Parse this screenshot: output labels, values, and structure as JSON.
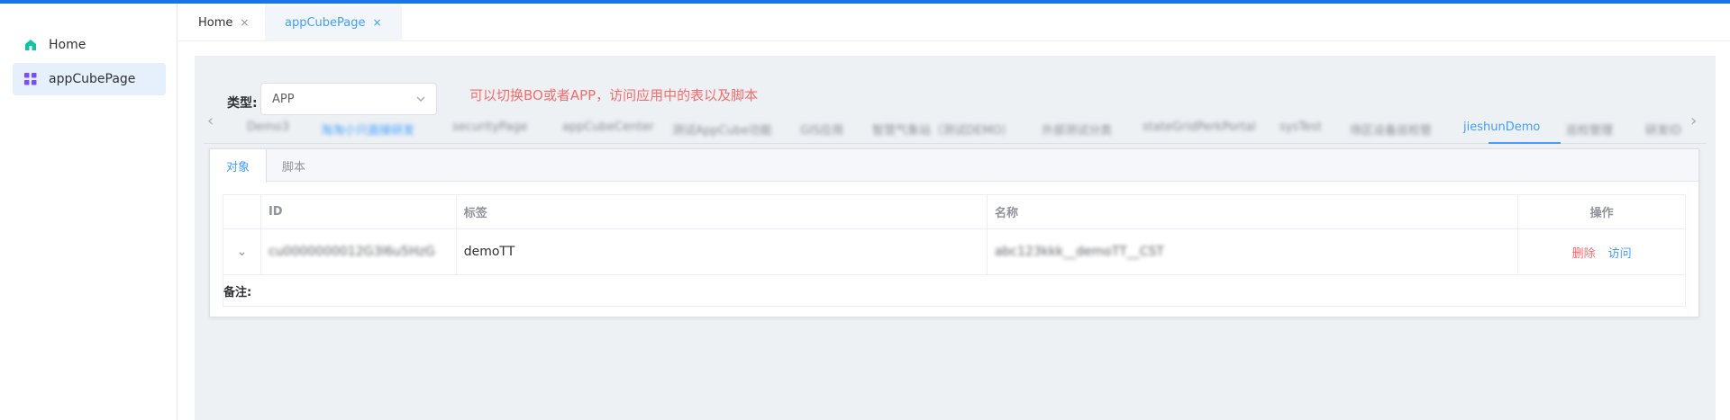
{
  "sidebar": {
    "items": [
      {
        "label": "Home",
        "icon": "home-icon",
        "active": false
      },
      {
        "label": "appCubePage",
        "icon": "grid-icon",
        "active": true
      }
    ]
  },
  "header": {
    "tabs": [
      {
        "label": "Home",
        "close": "×",
        "active": false
      },
      {
        "label": "appCubePage",
        "close": "×",
        "active": true
      }
    ]
  },
  "filter": {
    "type_label": "类型:",
    "type_value": "APP",
    "hint": "可以切换BO或者APP，访问应用中的表以及脚本"
  },
  "app_tabs": {
    "prev": "‹",
    "next": "›",
    "items": [
      "Demo3",
      "淘淘小只面接研发",
      "securityPage",
      "appCubeCenter",
      "测试AppCube功能",
      "GIS应用",
      "智慧气象站（测试DEMO）",
      "外部测试分类",
      "stateGridPerkPortal",
      "sysTest",
      "场区设备巡检管",
      "jieshunDemo",
      "巡检管理",
      "研发ID"
    ],
    "active": "jieshunDemo"
  },
  "card": {
    "tabs": [
      {
        "label": "对象",
        "active": true
      },
      {
        "label": "脚本",
        "active": false
      }
    ]
  },
  "table": {
    "headers": [
      "",
      "ID",
      "标签",
      "名称",
      "操作"
    ],
    "rows": [
      {
        "expand": "⌄",
        "id": "cu0000000012G3l6u5HzG",
        "label": "demoTT",
        "name": "abc123kkk__demoTT__CST",
        "actions": {
          "delete": "删除",
          "visit": "访问"
        }
      }
    ],
    "remark_label": "备注:"
  },
  "colors": {
    "accent": "#409eff",
    "danger": "#f56c6c",
    "topbar": "#1a73e8",
    "panel_bg": "#eef1f4"
  }
}
